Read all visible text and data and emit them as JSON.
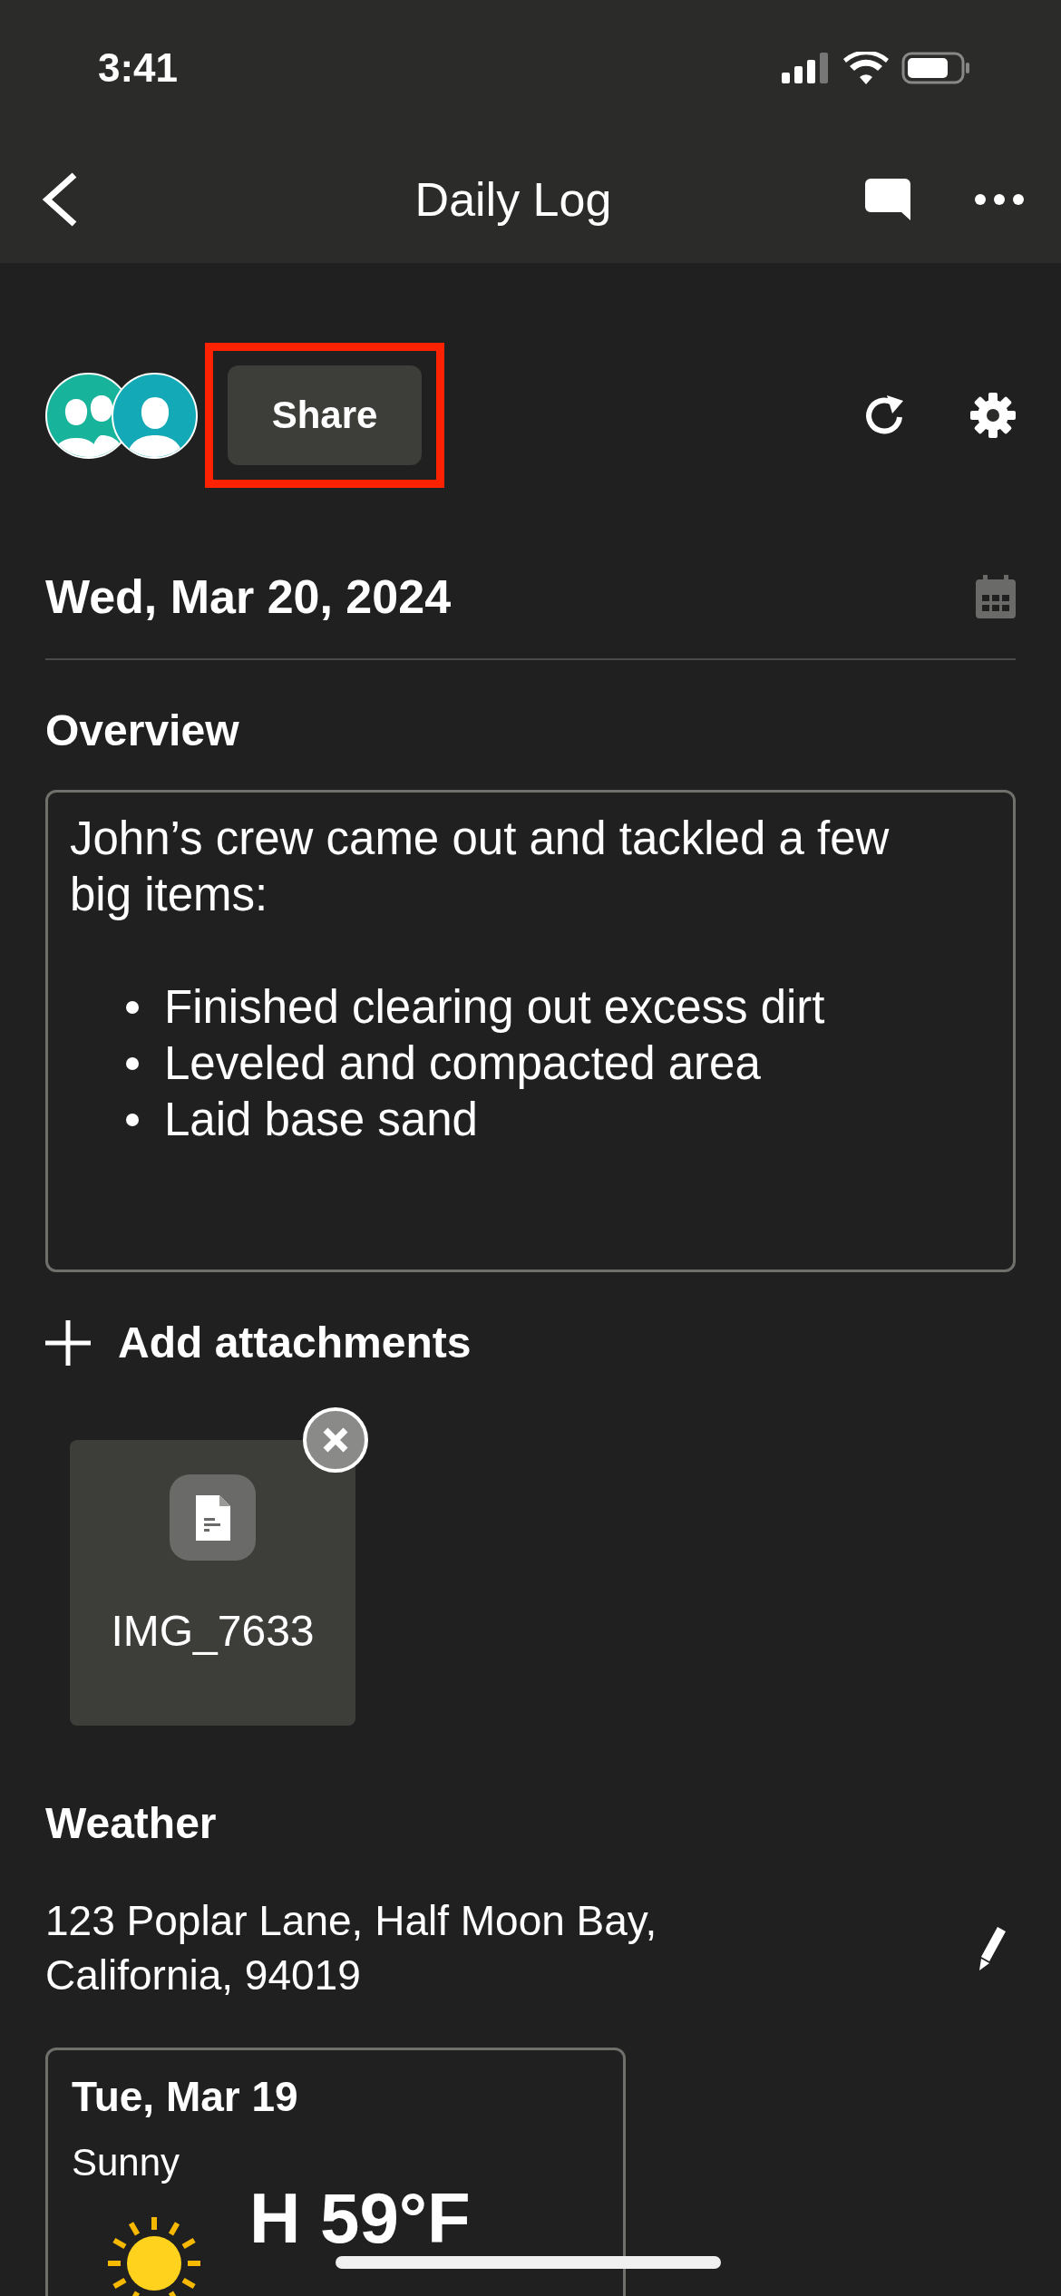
{
  "status_bar": {
    "time": "3:41"
  },
  "nav": {
    "title": "Daily Log"
  },
  "share": {
    "label": "Share",
    "highlighted": true
  },
  "date": "Wed, Mar 20, 2024",
  "overview": {
    "heading": "Overview",
    "intro": "John’s crew came out and tackled a few big items:",
    "bullets": [
      "Finished clearing out excess dirt",
      "Leveled and compacted area",
      "Laid base sand"
    ]
  },
  "attachments": {
    "add_label": "Add attachments",
    "items": [
      {
        "name": "IMG_7633"
      }
    ]
  },
  "weather": {
    "heading": "Weather",
    "address": "123 Poplar Lane, Half Moon Bay, California, 94019",
    "days": [
      {
        "date": "Tue, Mar 19",
        "condition": "Sunny",
        "high": "H 59°F"
      }
    ]
  }
}
